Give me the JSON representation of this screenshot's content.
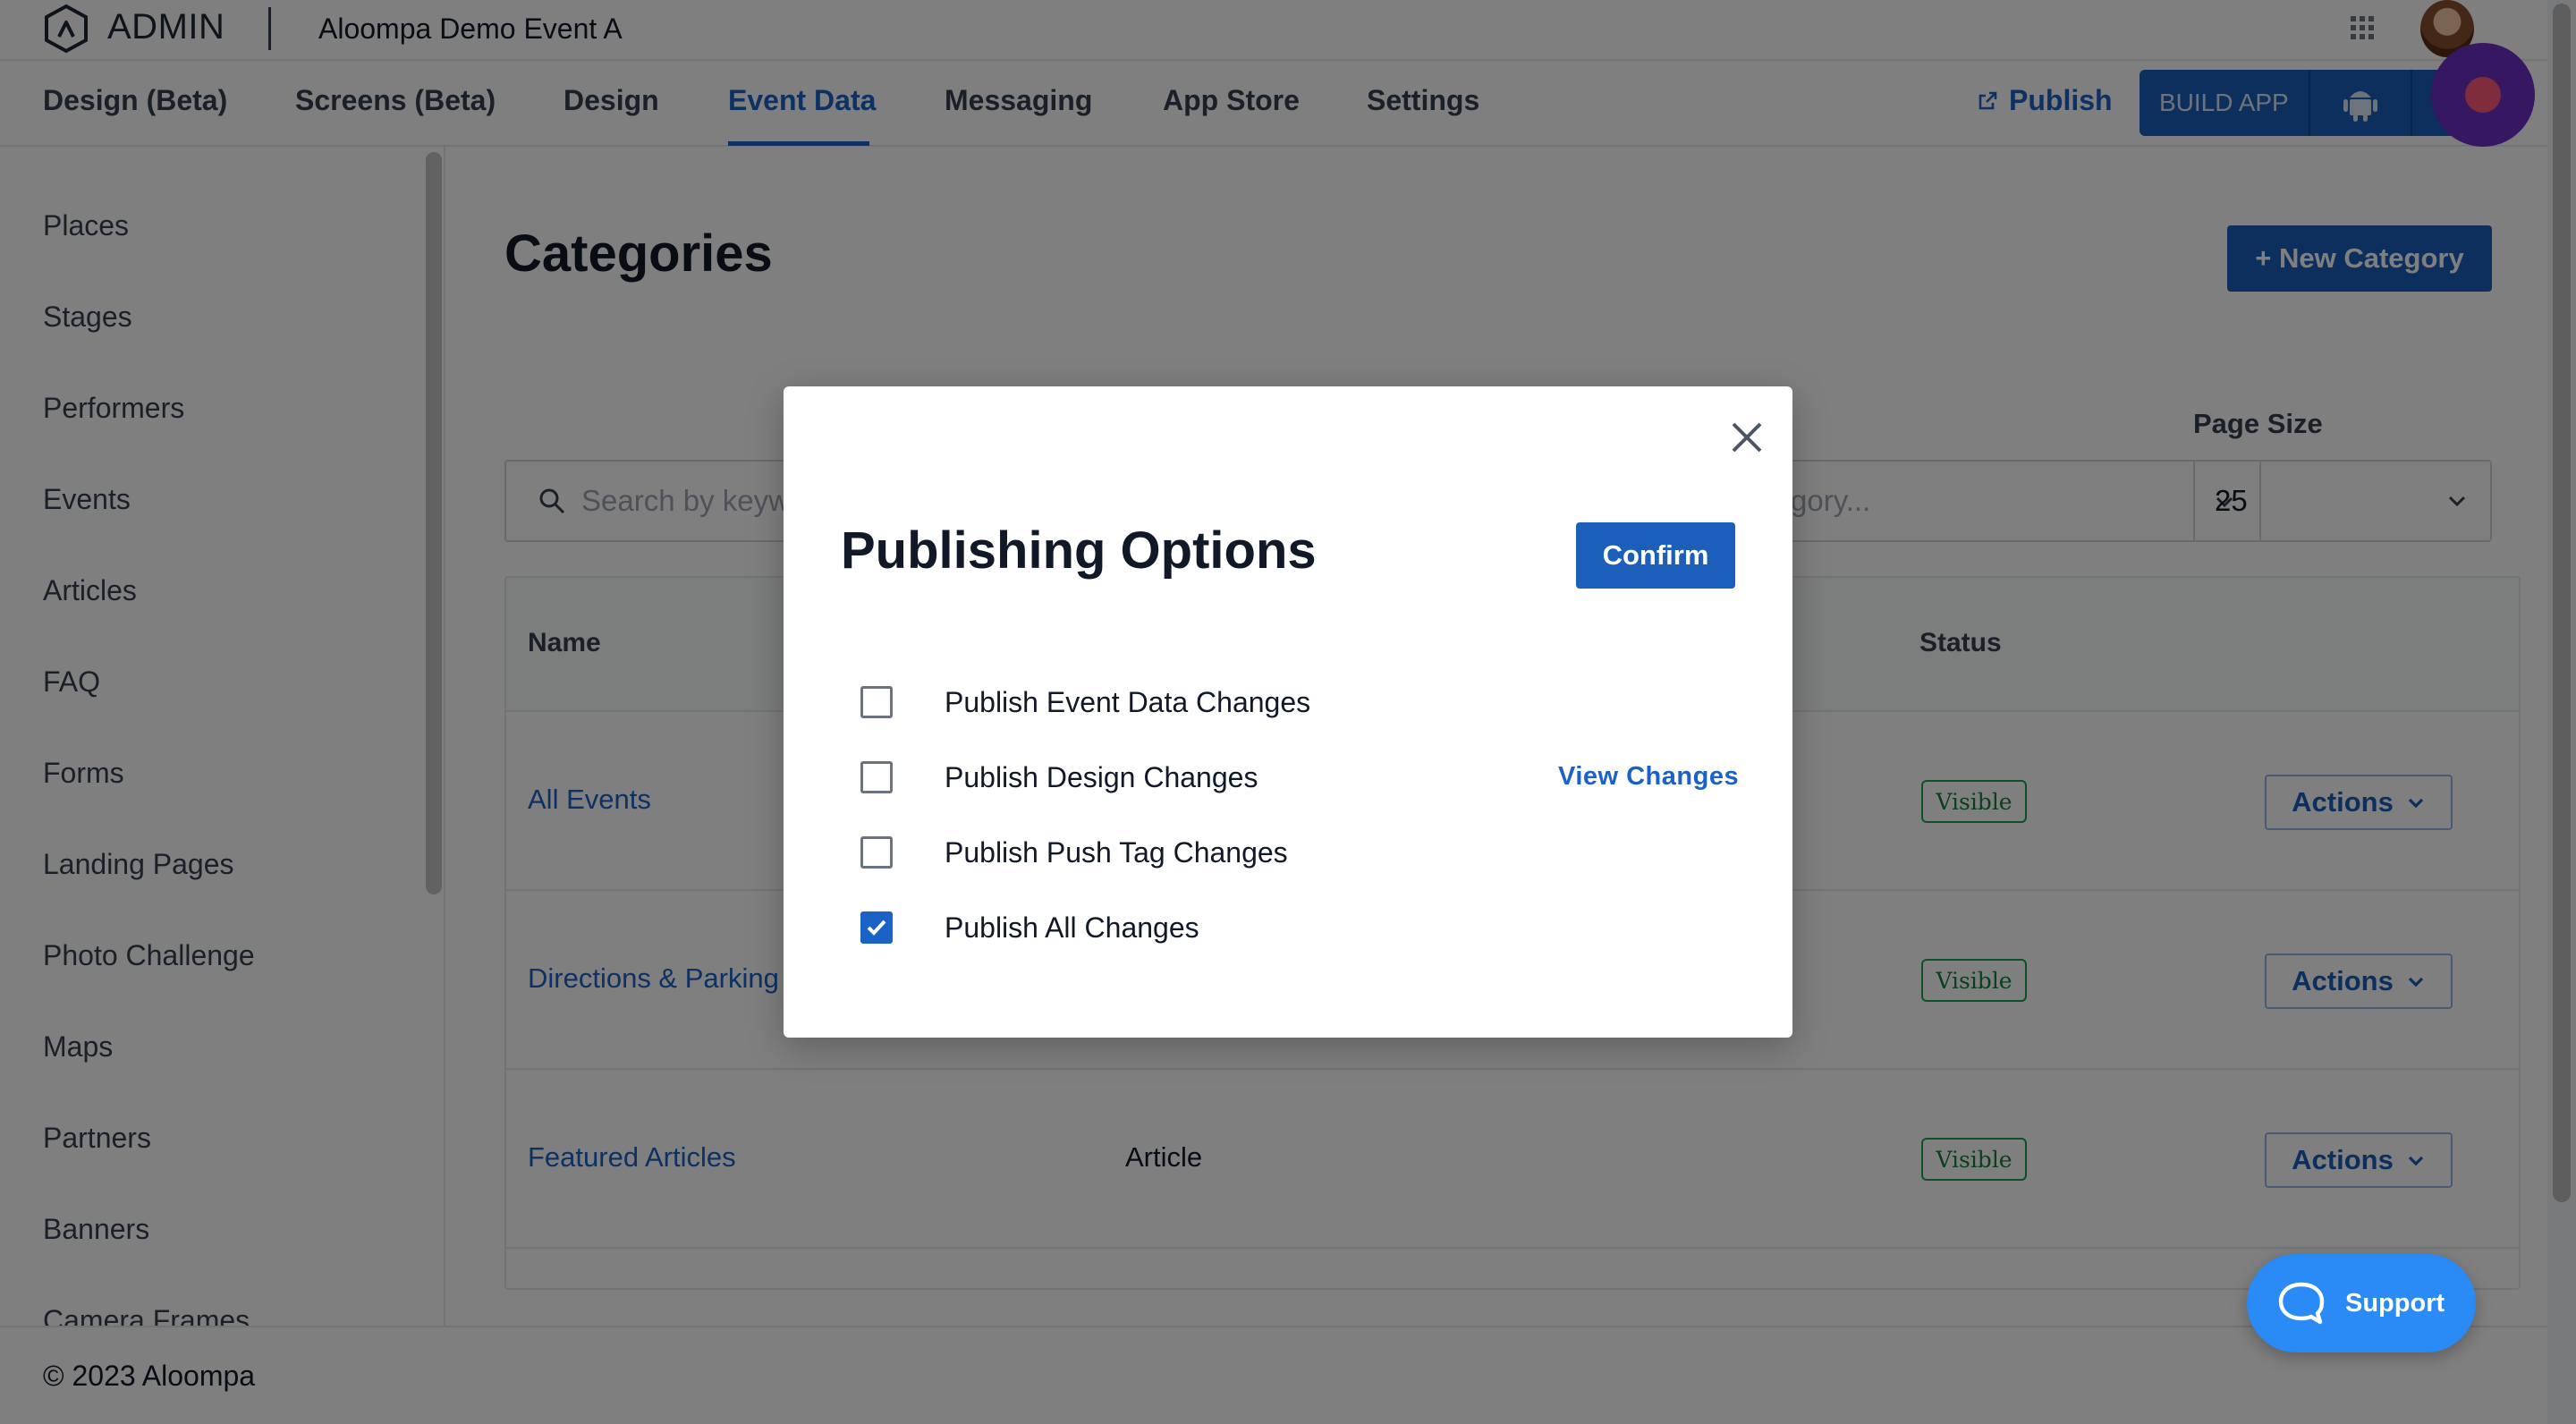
{
  "header": {
    "admin_label": "ADMIN",
    "event_title": "Aloompa Demo Event A"
  },
  "nav": {
    "tabs": [
      {
        "label": "Design (Beta)"
      },
      {
        "label": "Screens (Beta)"
      },
      {
        "label": "Design"
      },
      {
        "label": "Event Data",
        "active": true
      },
      {
        "label": "Messaging"
      },
      {
        "label": "App Store"
      },
      {
        "label": "Settings"
      }
    ],
    "publish_label": "Publish",
    "build_app_label": "BUILD APP"
  },
  "sidebar": {
    "items": [
      {
        "label": "Places"
      },
      {
        "label": "Stages"
      },
      {
        "label": "Performers"
      },
      {
        "label": "Events"
      },
      {
        "label": "Articles"
      },
      {
        "label": "FAQ"
      },
      {
        "label": "Forms"
      },
      {
        "label": "Landing Pages"
      },
      {
        "label": "Photo Challenge"
      },
      {
        "label": "Maps"
      },
      {
        "label": "Partners"
      },
      {
        "label": "Banners"
      },
      {
        "label": "Camera Frames"
      }
    ]
  },
  "main": {
    "title": "Categories",
    "new_category_label": "+ New Category",
    "search_placeholder": "Search by keyw",
    "category_placeholder": "gory...",
    "page_size_label": "Page Size",
    "page_size_value": "25",
    "table": {
      "headers": {
        "name": "Name",
        "status": "Status"
      },
      "rows": [
        {
          "name": "All Events",
          "type": "",
          "status": "Visible",
          "action": "Actions"
        },
        {
          "name": "Directions & Parking",
          "type": "",
          "status": "Visible",
          "action": "Actions"
        },
        {
          "name": "Featured Articles",
          "type": "Article",
          "status": "Visible",
          "action": "Actions"
        }
      ]
    }
  },
  "footer": {
    "copyright": "© 2023 Aloompa"
  },
  "support": {
    "label": "Support"
  },
  "modal": {
    "title": "Publishing Options",
    "confirm_label": "Confirm",
    "view_changes_label": "View Changes",
    "options": [
      {
        "label": "Publish Event Data Changes",
        "checked": false
      },
      {
        "label": "Publish Design Changes",
        "checked": false
      },
      {
        "label": "Publish Push Tag Changes",
        "checked": false
      },
      {
        "label": "Publish All Changes",
        "checked": true
      }
    ]
  },
  "colors": {
    "accent": "#1b62c7",
    "primary_button": "#1b5fba",
    "support_button": "#2a8af6",
    "record_fab": "#6b2fc4",
    "badge_green": "#16a34a"
  }
}
